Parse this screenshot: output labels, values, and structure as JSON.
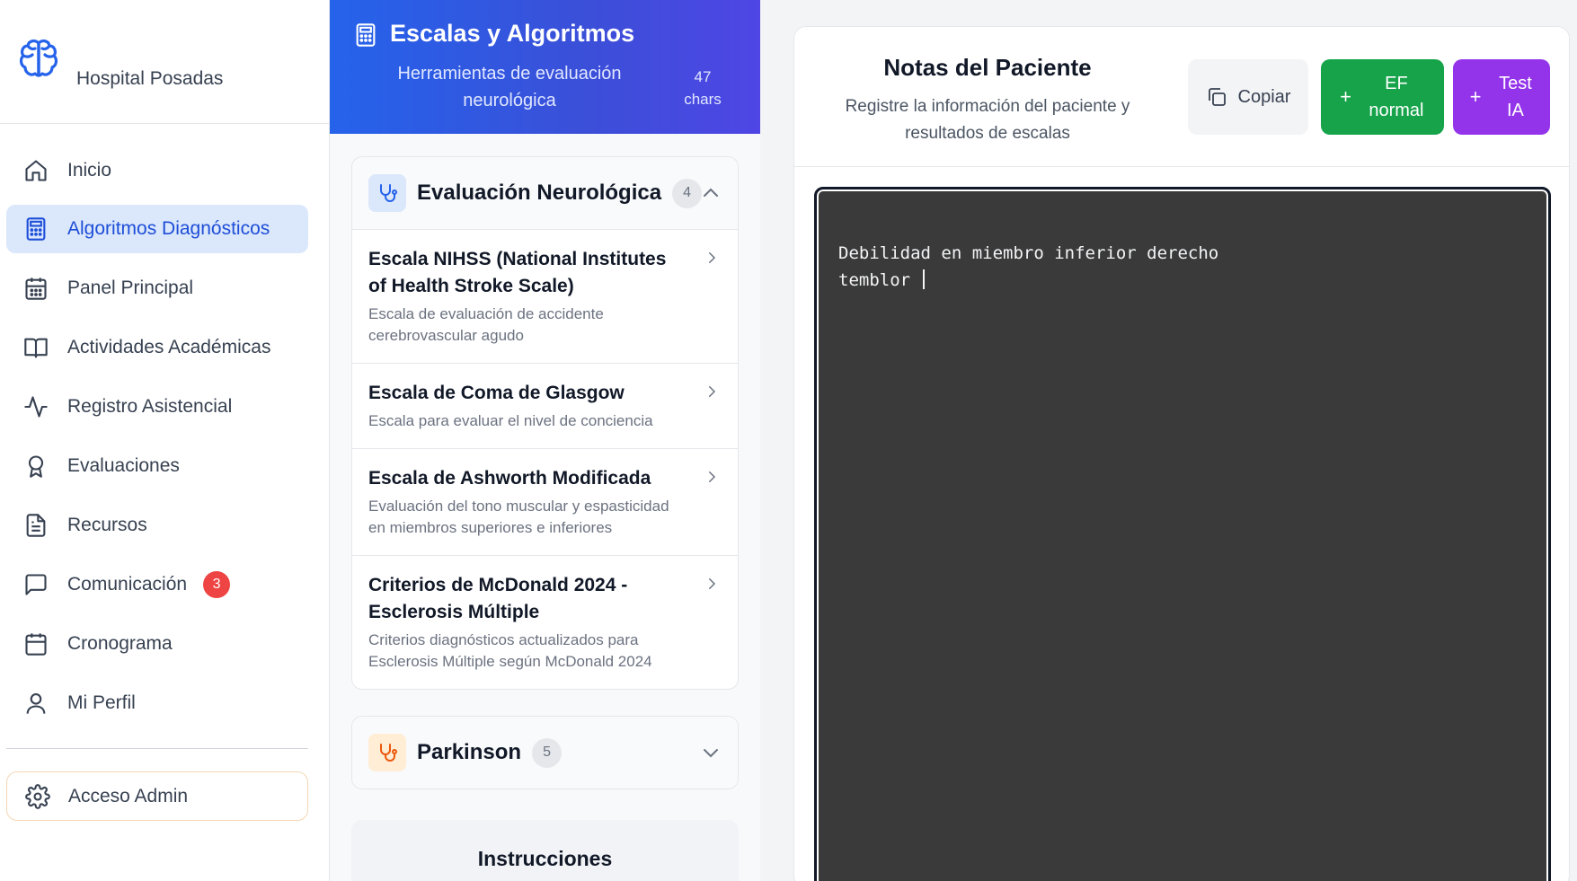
{
  "brand": {
    "name": "Hospital Posadas"
  },
  "sidebar": {
    "items": [
      {
        "label": "Inicio",
        "icon": "home-icon"
      },
      {
        "label": "Algoritmos Diagnósticos",
        "icon": "calculator-icon",
        "active": true
      },
      {
        "label": "Panel Principal",
        "icon": "calendar-grid-icon"
      },
      {
        "label": "Actividades Académicas",
        "icon": "book-icon"
      },
      {
        "label": "Registro Asistencial",
        "icon": "activity-icon"
      },
      {
        "label": "Evaluaciones",
        "icon": "award-icon"
      },
      {
        "label": "Recursos",
        "icon": "document-icon"
      },
      {
        "label": "Comunicación",
        "icon": "message-icon",
        "badge": "3"
      },
      {
        "label": "Cronograma",
        "icon": "calendar-icon"
      },
      {
        "label": "Mi Perfil",
        "icon": "user-icon"
      }
    ],
    "admin_label": "Acceso Admin"
  },
  "scales_panel": {
    "title": "Escalas y Algoritmos",
    "subtitle": "Herramientas de evaluación neurológica",
    "chars_count": "47",
    "chars_label": "chars",
    "groups": [
      {
        "title": "Evaluación Neurológica",
        "count": "4",
        "expanded": true,
        "items": [
          {
            "title": "Escala NIHSS (National Institutes of Health Stroke Scale)",
            "desc": "Escala de evaluación de accidente cerebrovascular agudo"
          },
          {
            "title": "Escala de Coma de Glasgow",
            "desc": "Escala para evaluar el nivel de conciencia"
          },
          {
            "title": "Escala de Ashworth Modificada",
            "desc": "Evaluación del tono muscular y espasticidad en miembros superiores e inferiores"
          },
          {
            "title": "Criterios de McDonald 2024 - Esclerosis Múltiple",
            "desc": "Criterios diagnósticos actualizados para Esclerosis Múltiple según McDonald 2024"
          }
        ]
      },
      {
        "title": "Parkinson",
        "count": "5",
        "expanded": false
      }
    ],
    "instructions_title": "Instrucciones"
  },
  "notes": {
    "title": "Notas del Paciente",
    "subtitle": "Registre la información del paciente y resultados de escalas",
    "copy_label": "Copiar",
    "ef_label": "EF normal",
    "ia_label": "Test IA",
    "plus": "+",
    "text": "Debilidad en miembro inferior derecho\ntemblor "
  },
  "colors": {
    "accent": "#2563eb",
    "active_bg": "#dbe7fb",
    "green": "#16a34a",
    "purple": "#9333ea",
    "badge": "#ef4444",
    "editor_bg": "#3a3a3a"
  }
}
